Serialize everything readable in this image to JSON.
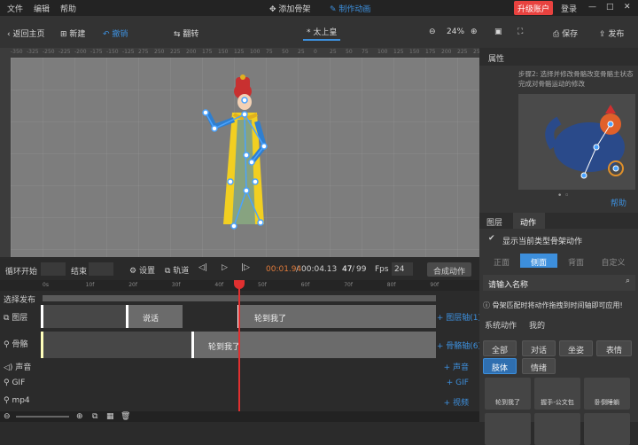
{
  "menu": {
    "file": "文件",
    "edit": "编辑",
    "help": "帮助"
  },
  "modes": {
    "add_bone": "添加骨架",
    "make_anim": "制作动画"
  },
  "account": {
    "upgrade": "升级账户",
    "login": "登录"
  },
  "toolbar": {
    "back": "返回主页",
    "new": "新建",
    "undo": "撤销",
    "flip": "翻转",
    "doc_title": "* 太上皇",
    "zoom": "24%",
    "save": "保存",
    "publish": "发布"
  },
  "ruler": {
    "h_ticks": [
      "-350",
      "-325",
      "-250",
      "-225",
      "-200",
      "-175",
      "-150",
      "-125",
      "275",
      "250",
      "225",
      "200",
      "175",
      "150",
      "125",
      "100",
      "75",
      "50",
      "25",
      "0",
      "25",
      "50",
      "75",
      "100",
      "125",
      "150",
      "175",
      "200",
      "225",
      "250"
    ]
  },
  "controls": {
    "loop_start": "循环开始",
    "end": "结束",
    "settings": "设置",
    "track": "轨道",
    "current_time": "00:01.94",
    "total_time": "00:04.13",
    "frame": "47",
    "total_frames": "99",
    "fps_label": "Fps",
    "fps": "24",
    "compose": "合成动作"
  },
  "timeline": {
    "ticks": [
      "0s",
      "10f",
      "20f",
      "30f",
      "40f",
      "50f",
      "60f",
      "70f",
      "80f",
      "90f"
    ],
    "rows": [
      {
        "label": "选择发布"
      },
      {
        "label": "图层",
        "add": "+ 图层轴(1)",
        "clips": [
          "说话",
          "轮到我了"
        ]
      },
      {
        "label": "骨骼",
        "add": "+ 骨骼轴(6)",
        "clips": [
          "轮到我了"
        ]
      },
      {
        "label": "声音",
        "add": "+ 声音"
      },
      {
        "label": "GIF",
        "add": "+ GIF"
      },
      {
        "label": "mp4",
        "add": "+ 视频"
      }
    ]
  },
  "right_panel": {
    "props_title": "属性",
    "hint": "步骤2: 选择并修改骨骼改变骨骼主状态完成对骨骼运动的修改",
    "help": "帮助",
    "tabs": [
      "图层",
      "动作"
    ],
    "show_matching": "显示当前类型骨架动作",
    "views": [
      "正面",
      "侧面",
      "背面",
      "自定义"
    ],
    "search_placeholder": "请输入名称",
    "notice": "骨架匹配时将动作拖拽到时间轴即可应用!",
    "subtabs": [
      "系统动作",
      "我的"
    ],
    "filters": [
      "全部",
      "对话",
      "坐姿",
      "表情",
      "肢体",
      "情绪"
    ],
    "actions": [
      "轮到我了",
      "握手-公文包",
      "卧倒睡躺"
    ]
  },
  "colors": {
    "accent": "#3d8fdc",
    "upgrade": "#e8423f",
    "playhead": "#e03030",
    "stage": "#7d7d7d"
  }
}
